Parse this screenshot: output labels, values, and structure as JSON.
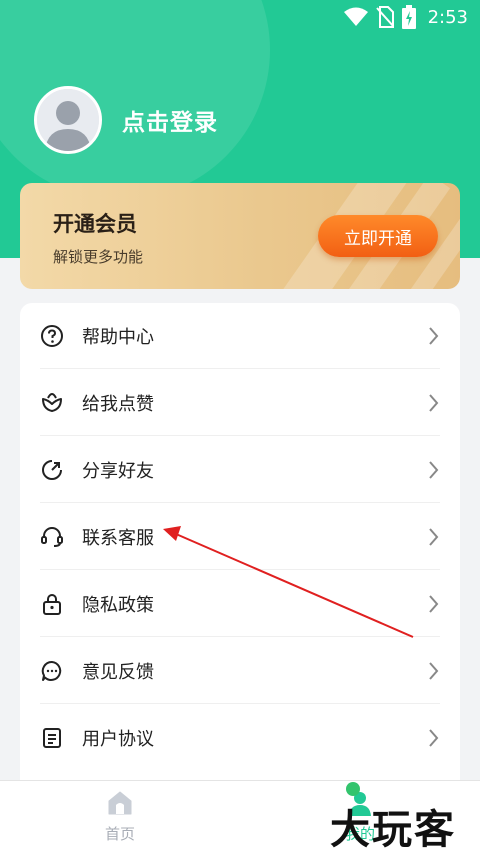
{
  "status_bar": {
    "time": "2:53"
  },
  "profile": {
    "login_text": "点击登录"
  },
  "vip": {
    "title": "开通会员",
    "subtitle": "解锁更多功能",
    "button_label": "立即开通"
  },
  "menu": {
    "items": [
      {
        "label": "帮助中心",
        "icon": "help-circle-icon"
      },
      {
        "label": "给我点赞",
        "icon": "flower-icon"
      },
      {
        "label": "分享好友",
        "icon": "share-icon"
      },
      {
        "label": "联系客服",
        "icon": "headset-icon"
      },
      {
        "label": "隐私政策",
        "icon": "lock-icon"
      },
      {
        "label": "意见反馈",
        "icon": "chat-bubble-icon"
      },
      {
        "label": "用户协议",
        "icon": "document-icon"
      }
    ]
  },
  "tabs": [
    {
      "label": "首页",
      "icon": "home-icon",
      "active": false
    },
    {
      "label": "我的",
      "icon": "user-icon",
      "active": true
    }
  ],
  "watermark": {
    "text": "大玩客"
  },
  "colors": {
    "primary": "#22c995",
    "vip_button": "#f25f13",
    "annotation_arrow": "#e02020"
  }
}
